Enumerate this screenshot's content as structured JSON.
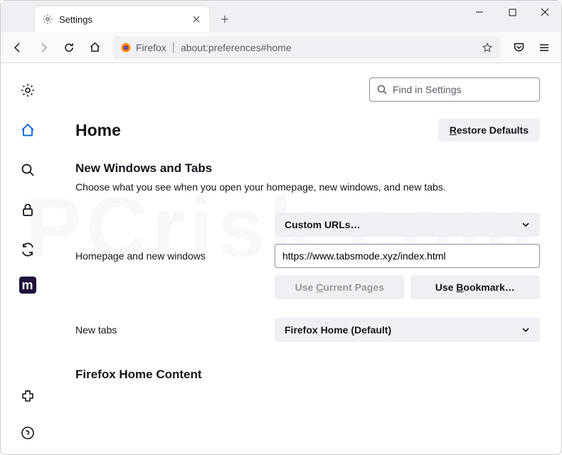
{
  "tab": {
    "title": "Settings"
  },
  "urlbar": {
    "identity": "Firefox",
    "url": "about:preferences#home"
  },
  "search": {
    "placeholder": "Find in Settings"
  },
  "page": {
    "title": "Home",
    "restore": "Restore Defaults"
  },
  "section1": {
    "title": "New Windows and Tabs",
    "desc": "Choose what you see when you open your homepage, new windows, and new tabs."
  },
  "homepage": {
    "label": "Homepage and new windows",
    "dropdown": "Custom URLs…",
    "url": "https://www.tabsmode.xyz/index.html",
    "use_current": "Use Current Pages",
    "use_bookmark": "Use Bookmark…"
  },
  "newtabs": {
    "label": "New tabs",
    "dropdown": "Firefox Home (Default)"
  },
  "section2": {
    "title": "Firefox Home Content"
  }
}
